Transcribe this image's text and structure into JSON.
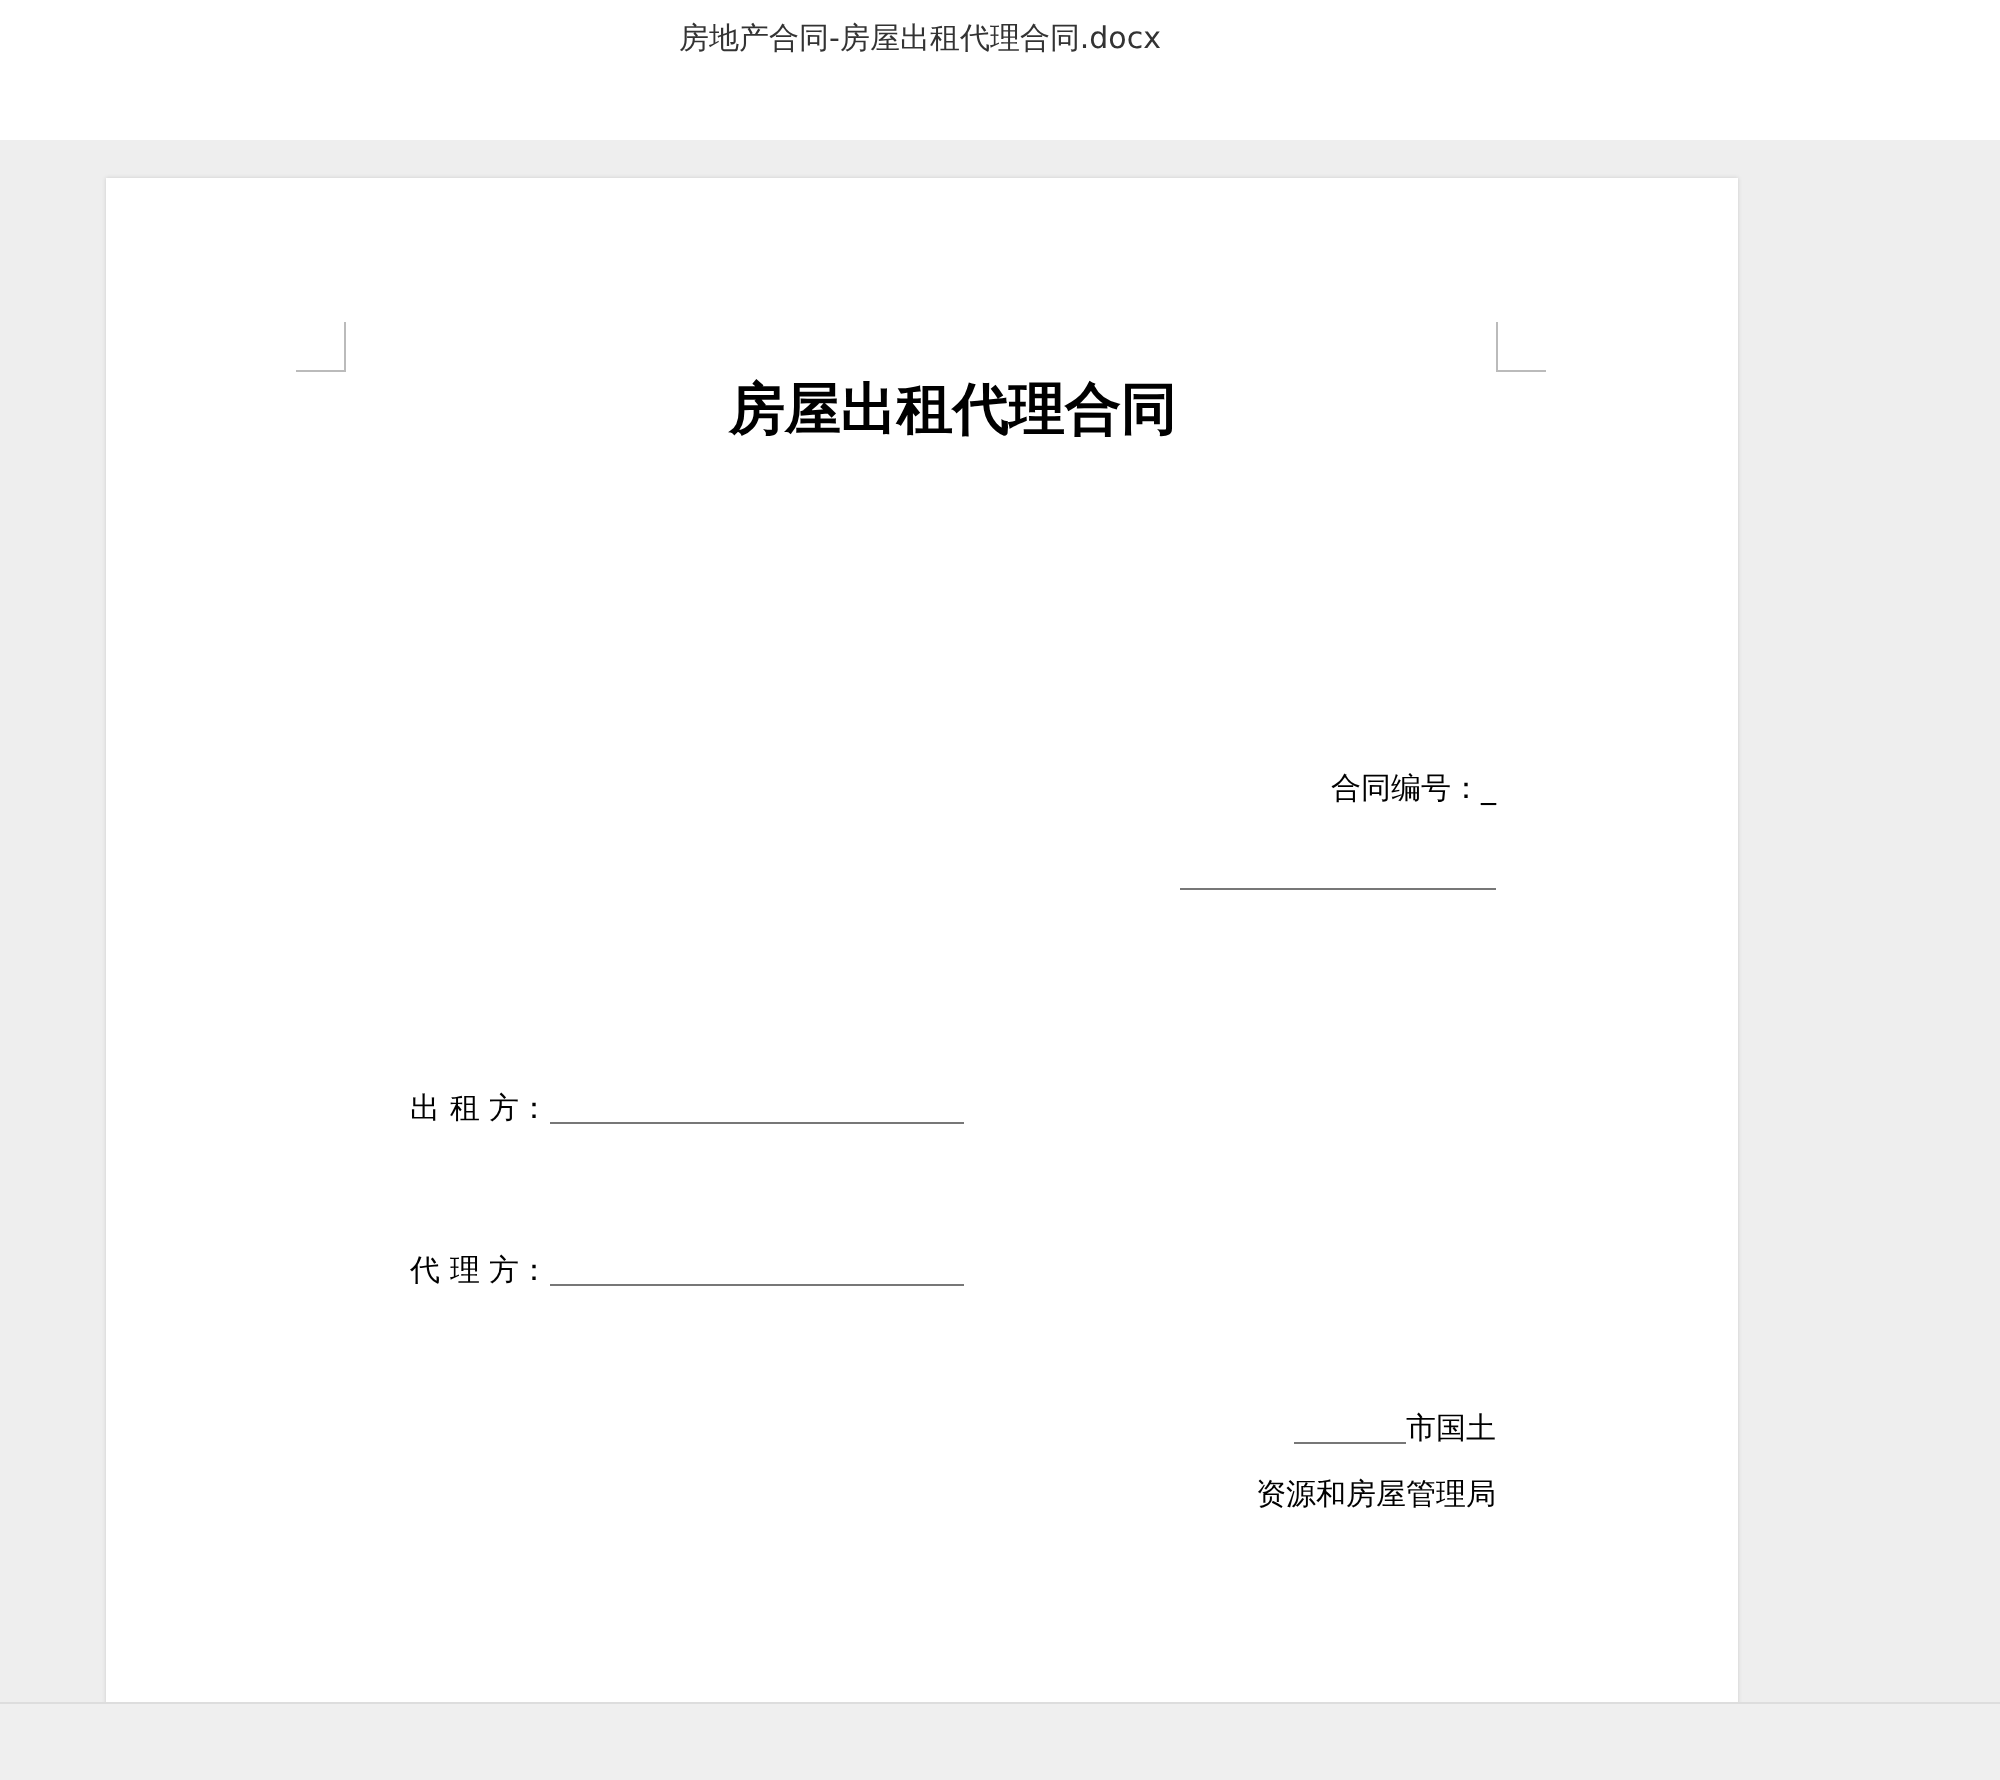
{
  "window": {
    "title": "房地产合同-房屋出租代理合同.docx"
  },
  "document": {
    "title": "房屋出租代理合同",
    "contract_number": {
      "label": "合同编号：_"
    },
    "parties": [
      {
        "label": "出 租 方："
      },
      {
        "label": "代 理 方："
      }
    ],
    "authority": {
      "line_1": "市国土",
      "line_2": "资源和房屋管理局"
    }
  }
}
